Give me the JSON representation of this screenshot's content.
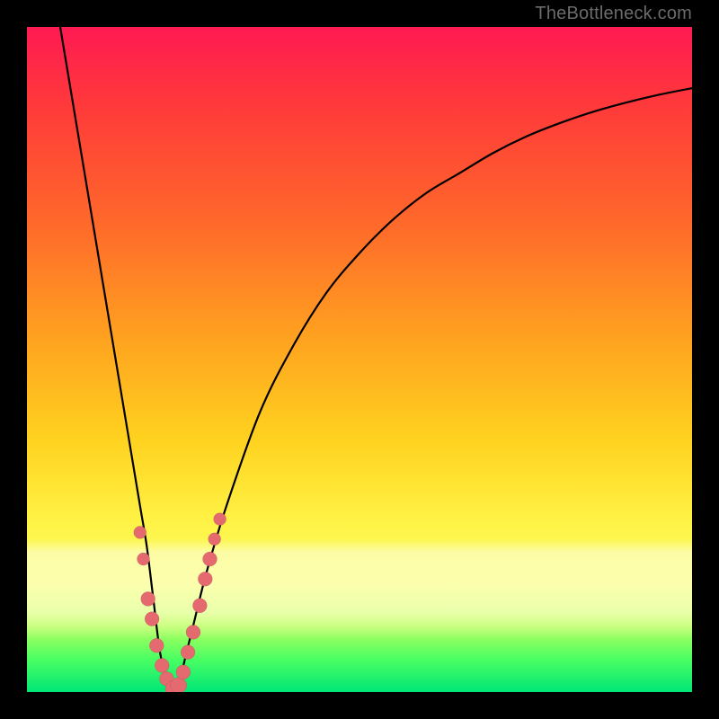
{
  "watermark": "TheBottleneck.com",
  "colors": {
    "frame_bg": "#000000",
    "curve_stroke": "#000000",
    "dot_fill": "#e46a6f",
    "gradient_stops": [
      "#ff1a52",
      "#ff3a3a",
      "#ff6a2a",
      "#ffa61f",
      "#ffd21f",
      "#fff244",
      "#f7ff68",
      "#b9ff5f",
      "#4bff62",
      "#00e676"
    ]
  },
  "chart_data": {
    "type": "line",
    "title": "",
    "xlabel": "",
    "ylabel": "",
    "xlim": [
      0,
      100
    ],
    "ylim": [
      0,
      100
    ],
    "grid": false,
    "annotations": [
      "TheBottleneck.com"
    ],
    "series": [
      {
        "name": "bottleneck-curve",
        "x": [
          5,
          7,
          9,
          11,
          13,
          15,
          17,
          18,
          19,
          20,
          21,
          22,
          23,
          24,
          25,
          27,
          30,
          35,
          40,
          45,
          50,
          55,
          60,
          65,
          70,
          75,
          80,
          85,
          90,
          95,
          100
        ],
        "y": [
          100,
          88,
          76,
          64,
          52,
          40,
          28,
          22,
          14,
          6,
          2,
          0,
          2,
          6,
          10,
          18,
          28,
          42,
          52,
          60,
          66,
          71,
          75,
          78,
          81,
          83.5,
          85.5,
          87.2,
          88.6,
          89.8,
          90.8
        ]
      }
    ],
    "scatter_points": {
      "name": "highlight-dots",
      "points": [
        {
          "x": 17.0,
          "y": 24,
          "r": 7
        },
        {
          "x": 17.5,
          "y": 20,
          "r": 7
        },
        {
          "x": 18.2,
          "y": 14,
          "r": 8
        },
        {
          "x": 18.8,
          "y": 11,
          "r": 8
        },
        {
          "x": 19.5,
          "y": 7,
          "r": 8
        },
        {
          "x": 20.3,
          "y": 4,
          "r": 8
        },
        {
          "x": 21.0,
          "y": 2,
          "r": 8
        },
        {
          "x": 22.0,
          "y": 0.5,
          "r": 9
        },
        {
          "x": 22.8,
          "y": 1,
          "r": 9
        },
        {
          "x": 23.5,
          "y": 3,
          "r": 8
        },
        {
          "x": 24.2,
          "y": 6,
          "r": 8
        },
        {
          "x": 25.0,
          "y": 9,
          "r": 8
        },
        {
          "x": 26.0,
          "y": 13,
          "r": 8
        },
        {
          "x": 26.8,
          "y": 17,
          "r": 8
        },
        {
          "x": 27.5,
          "y": 20,
          "r": 8
        },
        {
          "x": 28.2,
          "y": 23,
          "r": 7
        },
        {
          "x": 29.0,
          "y": 26,
          "r": 7
        }
      ]
    }
  }
}
